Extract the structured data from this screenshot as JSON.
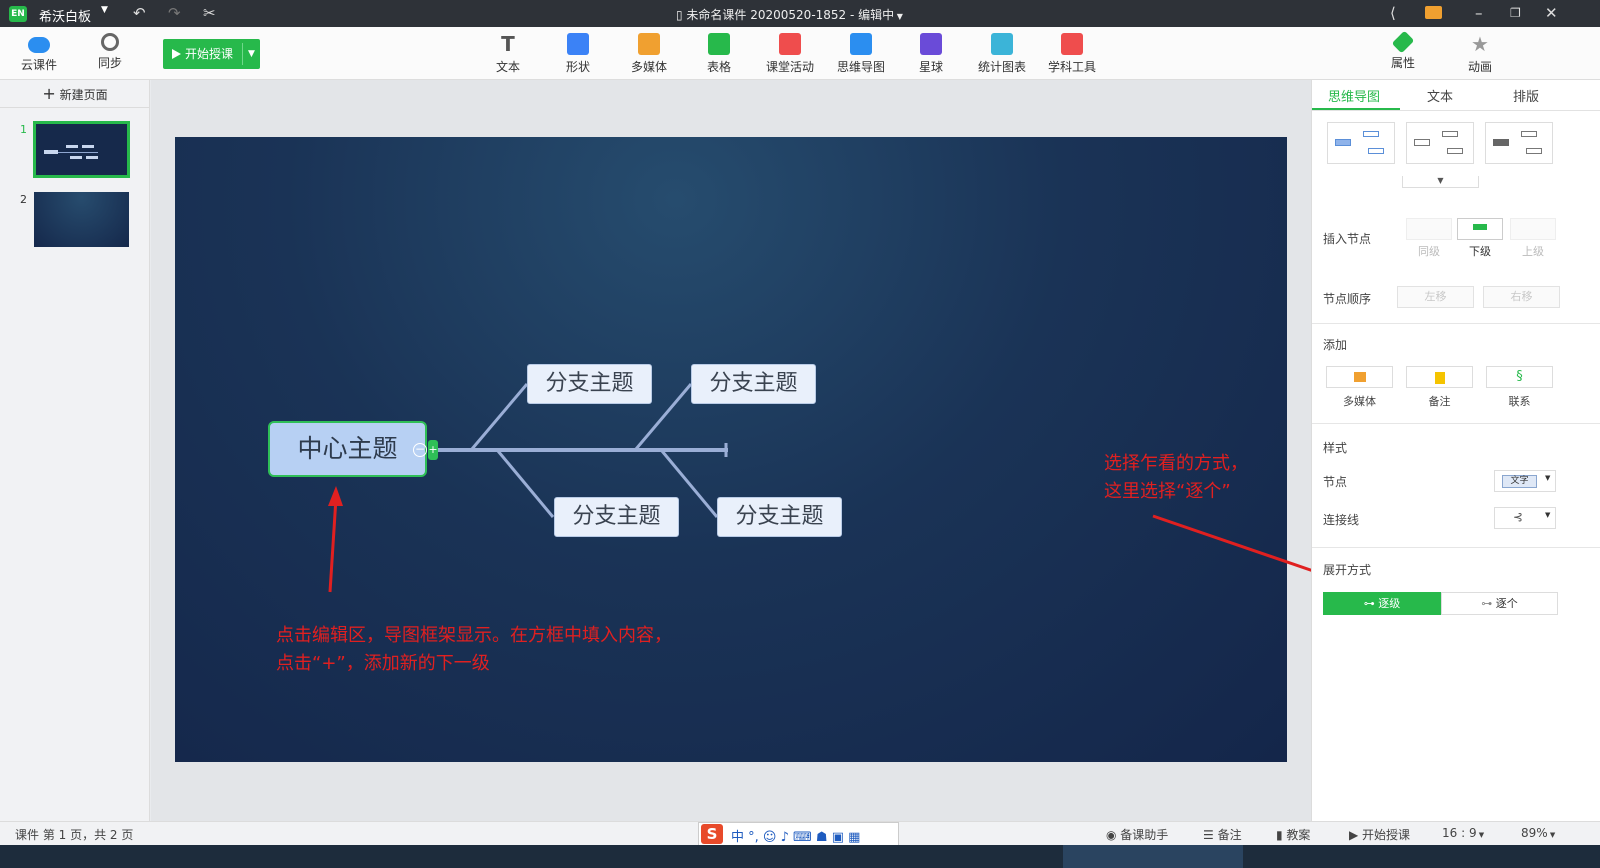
{
  "titlebar": {
    "app_name": "希沃白板",
    "doc_title": "未命名课件 20200520-1852 - 编辑中"
  },
  "toolbar": {
    "left": [
      {
        "label": "云课件",
        "icon": "cloud-icon",
        "color": "#2b8ef0"
      },
      {
        "label": "同步",
        "icon": "sync-icon",
        "color": "#555555"
      }
    ],
    "start_label": "开始授课",
    "tools": [
      {
        "label": "文本",
        "icon": "text-icon",
        "color": "#555555"
      },
      {
        "label": "形状",
        "icon": "shape-icon",
        "color": "#3b82f6"
      },
      {
        "label": "多媒体",
        "icon": "media-icon",
        "color": "#f0a030"
      },
      {
        "label": "表格",
        "icon": "table-icon",
        "color": "#27b94b"
      },
      {
        "label": "课堂活动",
        "icon": "activity-icon",
        "color": "#ef4d4d"
      },
      {
        "label": "思维导图",
        "icon": "mindmap-icon",
        "color": "#2b8ef0"
      },
      {
        "label": "星球",
        "icon": "planet-icon",
        "color": "#6a4bd8"
      },
      {
        "label": "统计图表",
        "icon": "chart-icon",
        "color": "#3bb4d8"
      },
      {
        "label": "学科工具",
        "icon": "subject-tools-icon",
        "color": "#ef4d4d"
      }
    ],
    "right": [
      {
        "label": "属性",
        "icon": "brush-icon",
        "color": "#27b94b"
      },
      {
        "label": "动画",
        "icon": "star-icon",
        "color": "#999999"
      }
    ]
  },
  "left_panel": {
    "new_page": "新建页面",
    "slides": [
      "1",
      "2"
    ]
  },
  "slide": {
    "center_topic": "中心主题",
    "branches": [
      "分支主题",
      "分支主题",
      "分支主题",
      "分支主题"
    ],
    "annotation_left": [
      "点击编辑区，导图框架显示。在方框中填入内容，",
      "点击“+”，添加新的下一级"
    ],
    "annotation_right": [
      "选择乍看的方式，",
      "这里选择“逐个”"
    ]
  },
  "right_panel": {
    "tabs": [
      "思维导图",
      "文本",
      "排版"
    ],
    "insert_node": {
      "label": "插入节点",
      "options": [
        "同级",
        "下级",
        "上级"
      ]
    },
    "node_order": {
      "label": "节点顺序",
      "options": [
        "左移",
        "右移"
      ]
    },
    "add": {
      "label": "添加",
      "options": [
        "多媒体",
        "备注",
        "联系"
      ]
    },
    "style": {
      "label": "样式",
      "node_label": "节点",
      "node_value": "文字",
      "line_label": "连接线"
    },
    "expand": {
      "label": "展开方式",
      "options": [
        "逐级",
        "逐个"
      ]
    }
  },
  "statusbar": {
    "page_info": "课件 第 1 页，共 2 页",
    "items": [
      "备课助手",
      "备注",
      "教案",
      "开始授课",
      "16 : 9",
      "89%"
    ]
  },
  "colors": {
    "accent": "#27b94b",
    "annotation": "#e02020",
    "slide_bg": "#14264a"
  }
}
